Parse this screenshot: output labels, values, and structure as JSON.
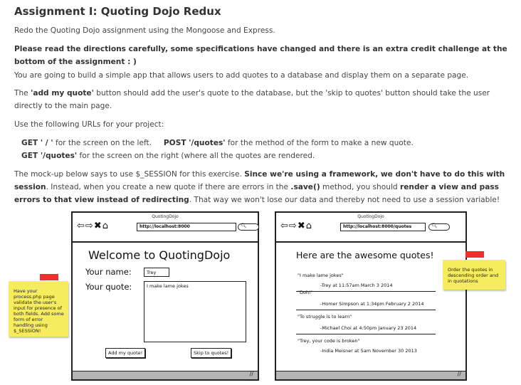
{
  "heading": "Assignment I: Quoting Dojo Redux",
  "intro": "Redo the Quoting Dojo assignment using the Mongoose and Express.",
  "notice": "Please read the directions carefully, some specifications have changed and there is an extra credit challenge at the bottom of the assignment : )",
  "build": "You are going to build a simple app that allows users to add quotes to a database and display them on a separate page.",
  "addquote": {
    "pre": "The ",
    "add_label": "'add my quote'",
    "mid": " button should add the user's quote to the database, but the 'skip to quotes' button should take the user directly to the main page."
  },
  "use_urls": "Use the following URLs for your project:",
  "routes": {
    "get1_method": "GET ' / '",
    "get1_text": " for the screen on the left.",
    "post_method": "POST '/quotes'",
    "post_text": " for the method of the form to make a new quote.",
    "get2_method": "GET '/quotes'",
    "get2_text": " for the screen on the right (where all the quotes are rendered."
  },
  "mockup_text": {
    "a": "The mock-up below says to use $_SESSION for this exercise. ",
    "b": "Since we're using a framework, we don't have to do this with session",
    "c": ". Instead, when you create a new quote if there are errors in the ",
    "d": ".save()",
    "e": " method, you should ",
    "f": "render a view and pass errors to that view instead of redirecting",
    "g": ". That way we won't lose our data and thereby not need to use a session variable!"
  },
  "left_browser": {
    "title": "QuotingDojo",
    "url": "http://localhost:8000",
    "welcome": "Welcome to QuotingDojo",
    "name_label": "Your name:",
    "name_value": "Trey",
    "quote_label": "Your quote:",
    "quote_value": "I make lame jokes",
    "add_button": "Add my quote!",
    "skip_button": "Skip to quotes!"
  },
  "right_browser": {
    "title": "QuotingDojo",
    "url": "http://localhost:8000/quotes",
    "heading": "Here are the awesome quotes!",
    "quotes": [
      {
        "text": "\"I make lame jokes\"",
        "author": "-Trey at 11:57am March 3 2014"
      },
      {
        "text": "\"Doh!\"",
        "author": "-Homer Simpson at 1:34pm February 2 2014"
      },
      {
        "text": "\"To struggle is to learn\"",
        "author": "-Michael Choi at 4:50pm January 23 2014"
      },
      {
        "text": "\"Trey, your code is broken\"",
        "author": "-India Meisner at 5am November 30 2013"
      }
    ]
  },
  "sticky_left": "Have your process.php page validate the user's input for presence of both fields. Add some form of error handling using $_SESSION!",
  "sticky_right": "Order the quotes in descending order and in quotations",
  "colors": {
    "sticky": "#f6ec5e",
    "tape": "#e8322a",
    "statusbar": "#b5b5b5"
  }
}
